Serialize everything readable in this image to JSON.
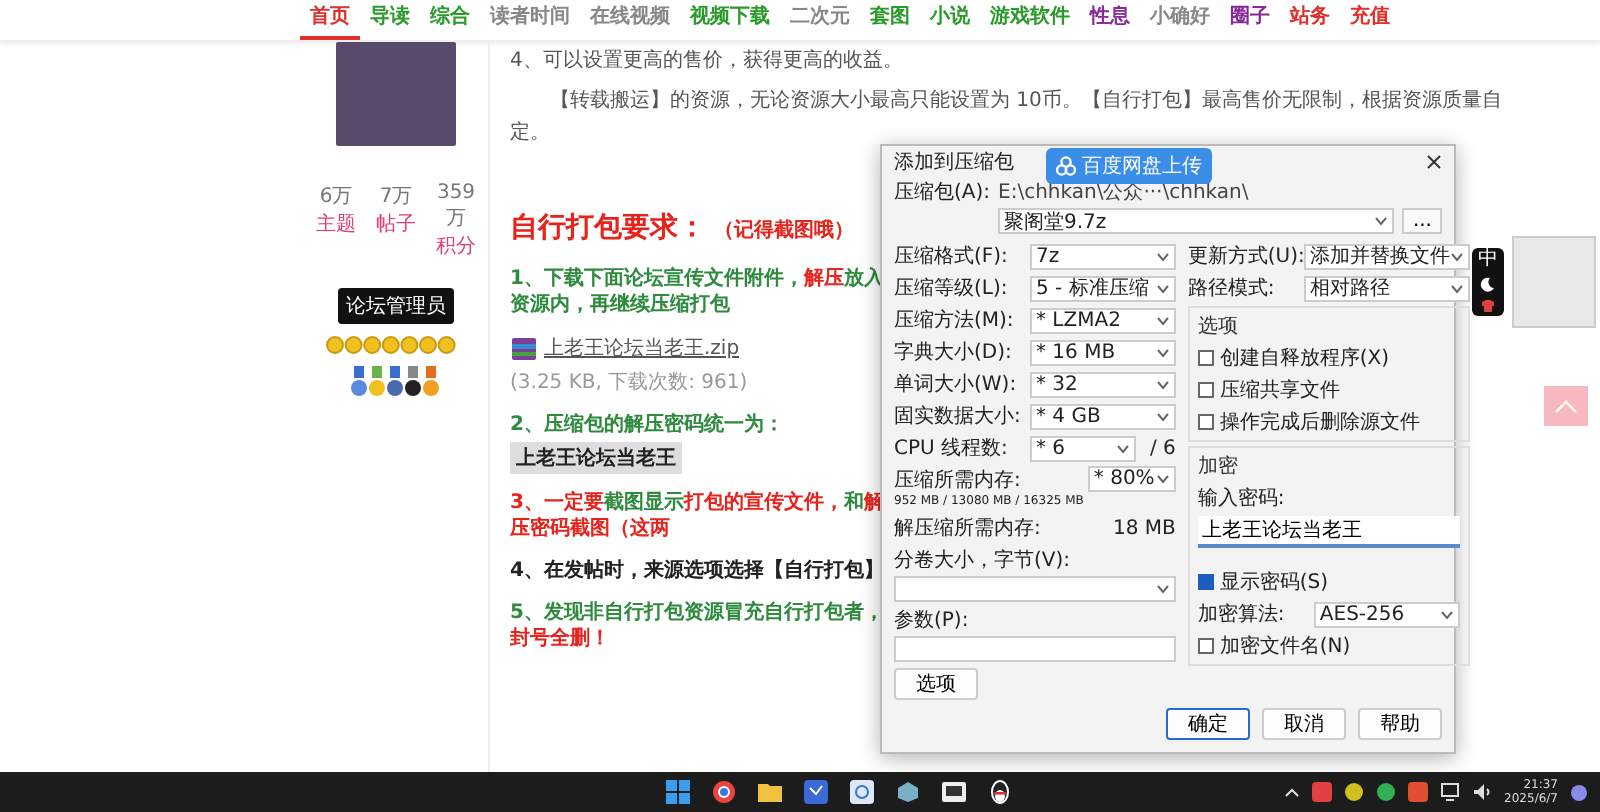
{
  "nav": [
    {
      "label": "首页",
      "color": "#e0302a",
      "selected": true
    },
    {
      "label": "导读",
      "color": "#2a9a2a",
      "selected": false
    },
    {
      "label": "综合",
      "color": "#2a9a2a",
      "selected": false
    },
    {
      "label": "读者时间",
      "color": "#888888",
      "selected": false
    },
    {
      "label": "在线视频",
      "color": "#888888",
      "selected": false
    },
    {
      "label": "视频下载",
      "color": "#2a9a2a",
      "selected": false
    },
    {
      "label": "二次元",
      "color": "#888888",
      "selected": false
    },
    {
      "label": "套图",
      "color": "#2a9a2a",
      "selected": false
    },
    {
      "label": "小说",
      "color": "#2a9a2a",
      "selected": false
    },
    {
      "label": "游戏软件",
      "color": "#2a9a2a",
      "selected": false
    },
    {
      "label": "性息",
      "color": "#8a2a9a",
      "selected": false
    },
    {
      "label": "小确好",
      "color": "#888888",
      "selected": false
    },
    {
      "label": "圈子",
      "color": "#8a2a9a",
      "selected": false
    },
    {
      "label": "站务",
      "color": "#e0302a",
      "selected": false
    },
    {
      "label": "充值",
      "color": "#e0302a",
      "selected": false
    }
  ],
  "profile": {
    "stats": [
      {
        "value": "6万",
        "label": "主题"
      },
      {
        "value": "7万",
        "label": "帖子"
      },
      {
        "value": "359万",
        "label": "积分"
      }
    ],
    "badge": "论坛管理员"
  },
  "article": {
    "paragraphs": [
      "4、可以设置更高的售价，获得更高的收益。",
      "【转载搬运】的资源，无论资源大小最高只能设置为 10币。【自行打包】最高售价无限制，根据资源质量自定。"
    ],
    "heading": "自行打包要求：",
    "heading_note": "（记得截图哦）",
    "steps": [
      {
        "kind": "text",
        "segments": [
          {
            "text": "1、下载下面论坛宣传文件附件，",
            "color": "#2e8b3e"
          },
          {
            "text": "解压",
            "color": "#e8231c"
          },
          {
            "text": "放入资源内，再继续压缩打包",
            "color": "#2e8b3e"
          }
        ]
      },
      {
        "kind": "attachment",
        "file": "上老王论坛当老王.zip",
        "meta": "(3.25 KB, 下载次数: 961)"
      },
      {
        "kind": "password",
        "segments": [
          {
            "text": "2、压缩包的解压密码统一为：",
            "color": "#2e8b3e"
          }
        ],
        "code": "上老王论坛当老王"
      },
      {
        "kind": "text",
        "segments": [
          {
            "text": "3、一定要",
            "color": "#e8231c"
          },
          {
            "text": "截图显示",
            "color": "#2e8b3e"
          },
          {
            "text": "打包的宣传文件，",
            "color": "#e8231c"
          },
          {
            "text": "和",
            "color": "#2e8b3e"
          },
          {
            "text": "解压密码截图（这两",
            "color": "#e8231c"
          }
        ]
      },
      {
        "kind": "text",
        "segments": [
          {
            "text": "4、在发帖时，来源选项选择【自行打包】",
            "color": "#222222"
          }
        ]
      },
      {
        "kind": "text",
        "segments": [
          {
            "text": "5、发现非自行打包资源冒充自行打包者，",
            "color": "#2e8b3e"
          },
          {
            "text": "封号全删！",
            "color": "#e8231c"
          }
        ]
      }
    ]
  },
  "dialog": {
    "title": "添加到压缩包",
    "archive": {
      "label": "压缩包(A):",
      "path": "E:\\chhkan\\公众···\\chhkan\\",
      "value": "聚阁堂9.7z"
    },
    "browse": "...",
    "left": [
      {
        "kind": "select",
        "label": "压缩格式(F):",
        "value": "7z"
      },
      {
        "kind": "select",
        "label": "压缩等级(L):",
        "value": "5 - 标准压缩"
      },
      {
        "kind": "select",
        "label": "压缩方法(M):",
        "value": "* LZMA2"
      },
      {
        "kind": "select",
        "label": "字典大小(D):",
        "value": "* 16 MB"
      },
      {
        "kind": "select",
        "label": "单词大小(W):",
        "value": "* 32"
      },
      {
        "kind": "select",
        "label": "固实数据大小:",
        "value": "* 4 GB"
      },
      {
        "kind": "select",
        "label": "CPU 线程数:",
        "value": "* 6",
        "suffix": "/ 6"
      },
      {
        "kind": "memory",
        "label": "压缩所需内存:",
        "detail": "952 MB / 13080 MB / 16325 MB",
        "value": "* 80%"
      },
      {
        "kind": "info",
        "label": "解压缩所需内存:",
        "value": "18 MB"
      },
      {
        "kind": "wide_select",
        "label": "分卷大小，字节(V):"
      },
      {
        "kind": "wide_input",
        "label": "参数(P):"
      }
    ],
    "options_button": "选项",
    "right": [
      {
        "label": "更新方式(U):",
        "value": "添加并替换文件"
      },
      {
        "label": "路径模式:",
        "value": "相对路径"
      }
    ],
    "options_group": {
      "title": "选项",
      "items": [
        {
          "label": "创建自释放程序(X)",
          "checked": false
        },
        {
          "label": "压缩共享文件",
          "checked": false
        },
        {
          "label": "操作完成后删除源文件",
          "checked": false
        }
      ]
    },
    "encryption": {
      "title": "加密",
      "password_label": "输入密码:",
      "password": "上老王论坛当老王",
      "show_password": {
        "label": "显示密码(S)",
        "checked": true
      },
      "algorithm_label": "加密算法:",
      "algorithm": "AES-256",
      "encrypt_names": {
        "label": "加密文件名(N)",
        "checked": false
      }
    },
    "buttons": [
      {
        "label": "确定",
        "default": true
      },
      {
        "label": "取消",
        "default": false
      },
      {
        "label": "帮助",
        "default": false
      }
    ]
  },
  "upload_badge": "百度网盘上传",
  "side_widget": {
    "label": "中"
  },
  "taskbar": {
    "time": "21:37",
    "date": "2025/6/7"
  }
}
